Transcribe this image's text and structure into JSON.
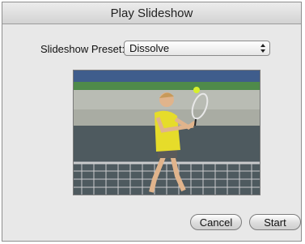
{
  "dialog": {
    "title": "Play Slideshow"
  },
  "preset": {
    "label": "Slideshow Preset:",
    "selected": "Dissolve",
    "arrow_icon": "updown-chevron-icon"
  },
  "preview": {
    "description_icon": "tennis-player-photo"
  },
  "buttons": {
    "cancel": "Cancel",
    "start": "Start"
  }
}
